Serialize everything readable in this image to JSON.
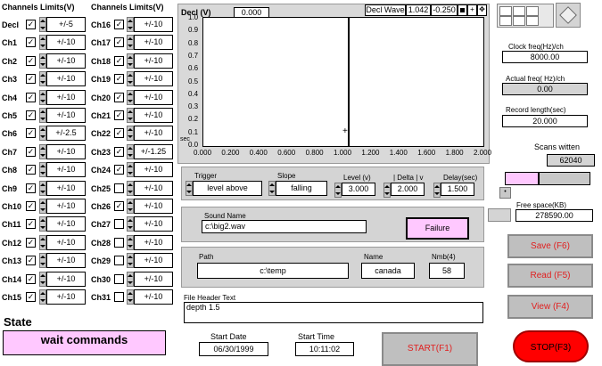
{
  "channels": {
    "header_left": "Channels Limits(V)",
    "header_right": "Channels Limits(V)",
    "left": [
      {
        "name": "Decl",
        "checked": true,
        "limit": "+/-5"
      },
      {
        "name": "Ch1",
        "checked": true,
        "limit": "+/-10"
      },
      {
        "name": "Ch2",
        "checked": true,
        "limit": "+/-10"
      },
      {
        "name": "Ch3",
        "checked": true,
        "limit": "+/-10"
      },
      {
        "name": "Ch4",
        "checked": true,
        "limit": "+/-10"
      },
      {
        "name": "Ch5",
        "checked": true,
        "limit": "+/-10"
      },
      {
        "name": "Ch6",
        "checked": true,
        "limit": "+/-2.5"
      },
      {
        "name": "Ch7",
        "checked": true,
        "limit": "+/-10"
      },
      {
        "name": "Ch8",
        "checked": true,
        "limit": "+/-10"
      },
      {
        "name": "Ch9",
        "checked": true,
        "limit": "+/-10"
      },
      {
        "name": "Ch10",
        "checked": true,
        "limit": "+/-10"
      },
      {
        "name": "Ch11",
        "checked": true,
        "limit": "+/-10"
      },
      {
        "name": "Ch12",
        "checked": true,
        "limit": "+/-10"
      },
      {
        "name": "Ch13",
        "checked": true,
        "limit": "+/-10"
      },
      {
        "name": "Ch14",
        "checked": true,
        "limit": "+/-10"
      },
      {
        "name": "Ch15",
        "checked": true,
        "limit": "+/-10"
      }
    ],
    "right": [
      {
        "name": "Ch16",
        "checked": true,
        "limit": "+/-10"
      },
      {
        "name": "Ch17",
        "checked": true,
        "limit": "+/-10"
      },
      {
        "name": "Ch18",
        "checked": true,
        "limit": "+/-10"
      },
      {
        "name": "Ch19",
        "checked": true,
        "limit": "+/-10"
      },
      {
        "name": "Ch20",
        "checked": true,
        "limit": "+/-10"
      },
      {
        "name": "Ch21",
        "checked": true,
        "limit": "+/-10"
      },
      {
        "name": "Ch22",
        "checked": true,
        "limit": "+/-10"
      },
      {
        "name": "Ch23",
        "checked": true,
        "limit": "+/-1.25"
      },
      {
        "name": "Ch24",
        "checked": true,
        "limit": "+/-10"
      },
      {
        "name": "Ch25",
        "checked": false,
        "limit": "+/-10"
      },
      {
        "name": "Ch26",
        "checked": true,
        "limit": "+/-10"
      },
      {
        "name": "Ch27",
        "checked": false,
        "limit": "+/-10"
      },
      {
        "name": "Ch28",
        "checked": false,
        "limit": "+/-10"
      },
      {
        "name": "Ch29",
        "checked": false,
        "limit": "+/-10"
      },
      {
        "name": "Ch30",
        "checked": false,
        "limit": "+/-10"
      },
      {
        "name": "Ch31",
        "checked": false,
        "limit": "+/-10"
      }
    ]
  },
  "graph": {
    "title": "Decl (V)",
    "readout": "0.000",
    "legend_label": "Decl Wave",
    "cursor_x": "1.042",
    "cursor_y": "-0.250",
    "y_unit": "sec",
    "y_ticks": [
      "1.0",
      "0.9",
      "0.8",
      "0.7",
      "0.6",
      "0.5",
      "0.4",
      "0.3",
      "0.2",
      "0.1",
      "0.0"
    ],
    "x_ticks": [
      "0.000",
      "0.200",
      "0.400",
      "0.600",
      "0.800",
      "1.000",
      "1.200",
      "1.400",
      "1.600",
      "1.800",
      "2.000"
    ]
  },
  "trigger": {
    "trigger_label": "Trigger",
    "trigger_value": "level above",
    "slope_label": "Slope",
    "slope_value": "falling",
    "level_label": "Level (v)",
    "level_value": "3.000",
    "delta_label": "| Delta | v",
    "delta_value": "2.000",
    "delay_label": "Delay(sec)",
    "delay_value": "1.500"
  },
  "sound": {
    "label": "Sound Name",
    "value": "c:\\big2.wav",
    "status": "Failure"
  },
  "file": {
    "path_label": "Path",
    "path_value": "c:\\temp",
    "name_label": "Name",
    "name_value": "canada",
    "nmb_label": "Nmb(4)",
    "nmb_value": "58"
  },
  "header_text": {
    "label": "File Header Text",
    "value": "depth 1.5"
  },
  "state": {
    "label": "State",
    "value": "wait commands"
  },
  "start": {
    "date_label": "Start Date",
    "date_value": "06/30/1999",
    "time_label": "Start Time",
    "time_value": "10:11:02"
  },
  "right_panel": {
    "clock_label": "Clock freq(Hz)/ch",
    "clock_value": "8000.00",
    "actual_label": "Actual freq( Hz)/ch",
    "actual_value": "0.00",
    "record_label": "Record length(sec)",
    "record_value": "20.000",
    "scans_label": "Scans witten",
    "scans_value": "62040",
    "progress": 0.38,
    "free_label": "Free space(KB)",
    "free_value": "278590.00"
  },
  "buttons": {
    "save": "Save (F6)",
    "read": "Read (F5)",
    "view": "View (F4)",
    "start": "START(F1)",
    "stop": "STOP(F3)"
  },
  "colors": {
    "pink": "#ffc8ff",
    "stop_red": "#ff0000"
  }
}
